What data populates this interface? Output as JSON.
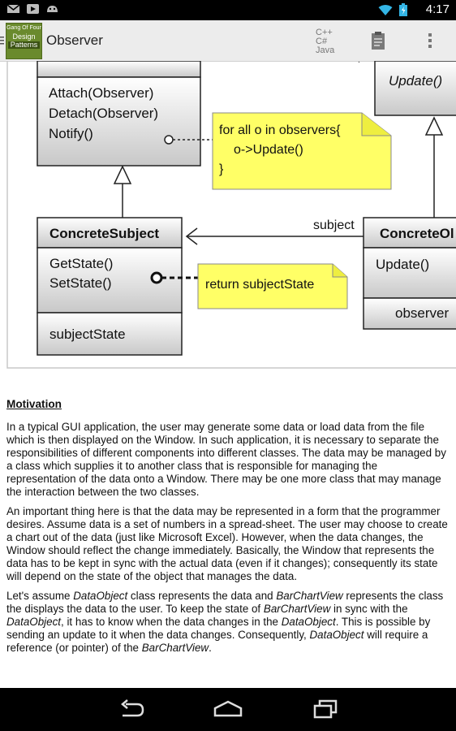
{
  "app": {
    "title": "Observer",
    "icon_label_1": "Gang Of Four",
    "icon_label_2": "Design",
    "icon_label_3": "Patterns"
  },
  "status": {
    "time": "4:17",
    "icons": [
      "gmail-icon",
      "youtube-icon",
      "android-icon",
      "wifi-icon",
      "battery-icon"
    ]
  },
  "actions": {
    "lang_line1": "C++",
    "lang_line2": "C#",
    "lang_line3": "Java"
  },
  "diagram": {
    "subject_methods": [
      "Attach(Observer)",
      "Detach(Observer)",
      "Notify()"
    ],
    "observer_method": "Update()",
    "notify_note": [
      "for all o in observers{",
      "o->Update()",
      "}"
    ],
    "concrete_subject_name": "ConcreteSubject",
    "concrete_subject_methods": [
      "GetState()",
      "SetState()"
    ],
    "concrete_subject_field": "subjectState",
    "getstate_note": "return subjectState",
    "assoc_label": "subject",
    "concrete_observer_name": "ConcreteOl",
    "concrete_observer_method": "Update()",
    "concrete_observer_field": "observer"
  },
  "article": {
    "heading": "Motivation",
    "p1": "In a typical GUI application, the user may generate some data or load data from the file which is then displayed on the Window. In such application, it is necessary to separate the responsibilities of different components into different classes. The data may be managed by a class which supplies it to another class that is responsible for managing the representation of the data onto a Window. There may be one more class that may manage the interaction between the two classes.",
    "p2": "An important thing here is that the data may be represented in a form that the programmer desires. Assume data is a set of numbers in a spread-sheet. The user may choose to create a chart out of the data (just like Microsoft Excel). However, when the data changes, the Window should reflect the change immediately. Basically, the Window that represents the data has to be kept in sync with the actual data (even if it changes); consequently its state will depend on the state of the object that manages the data.",
    "p3": {
      "t1": "Let's assume ",
      "i1": "DataObject",
      "t2": " class represents the data and ",
      "i2": "BarChartView",
      "t3": " represents the class the displays the data to the user. To keep the state of ",
      "i3": "BarChartView",
      "t4": " in sync with the ",
      "i4": "DataObject",
      "t5": ", it has to know when the data changes in the ",
      "i5": "DataObject",
      "t6": ". This is possible by sending an update to it when the data changes. Consequently, ",
      "i6": "DataObject",
      "t7": " will require a reference (or pointer) of the ",
      "i7": "BarChartView",
      "t8": "."
    }
  }
}
